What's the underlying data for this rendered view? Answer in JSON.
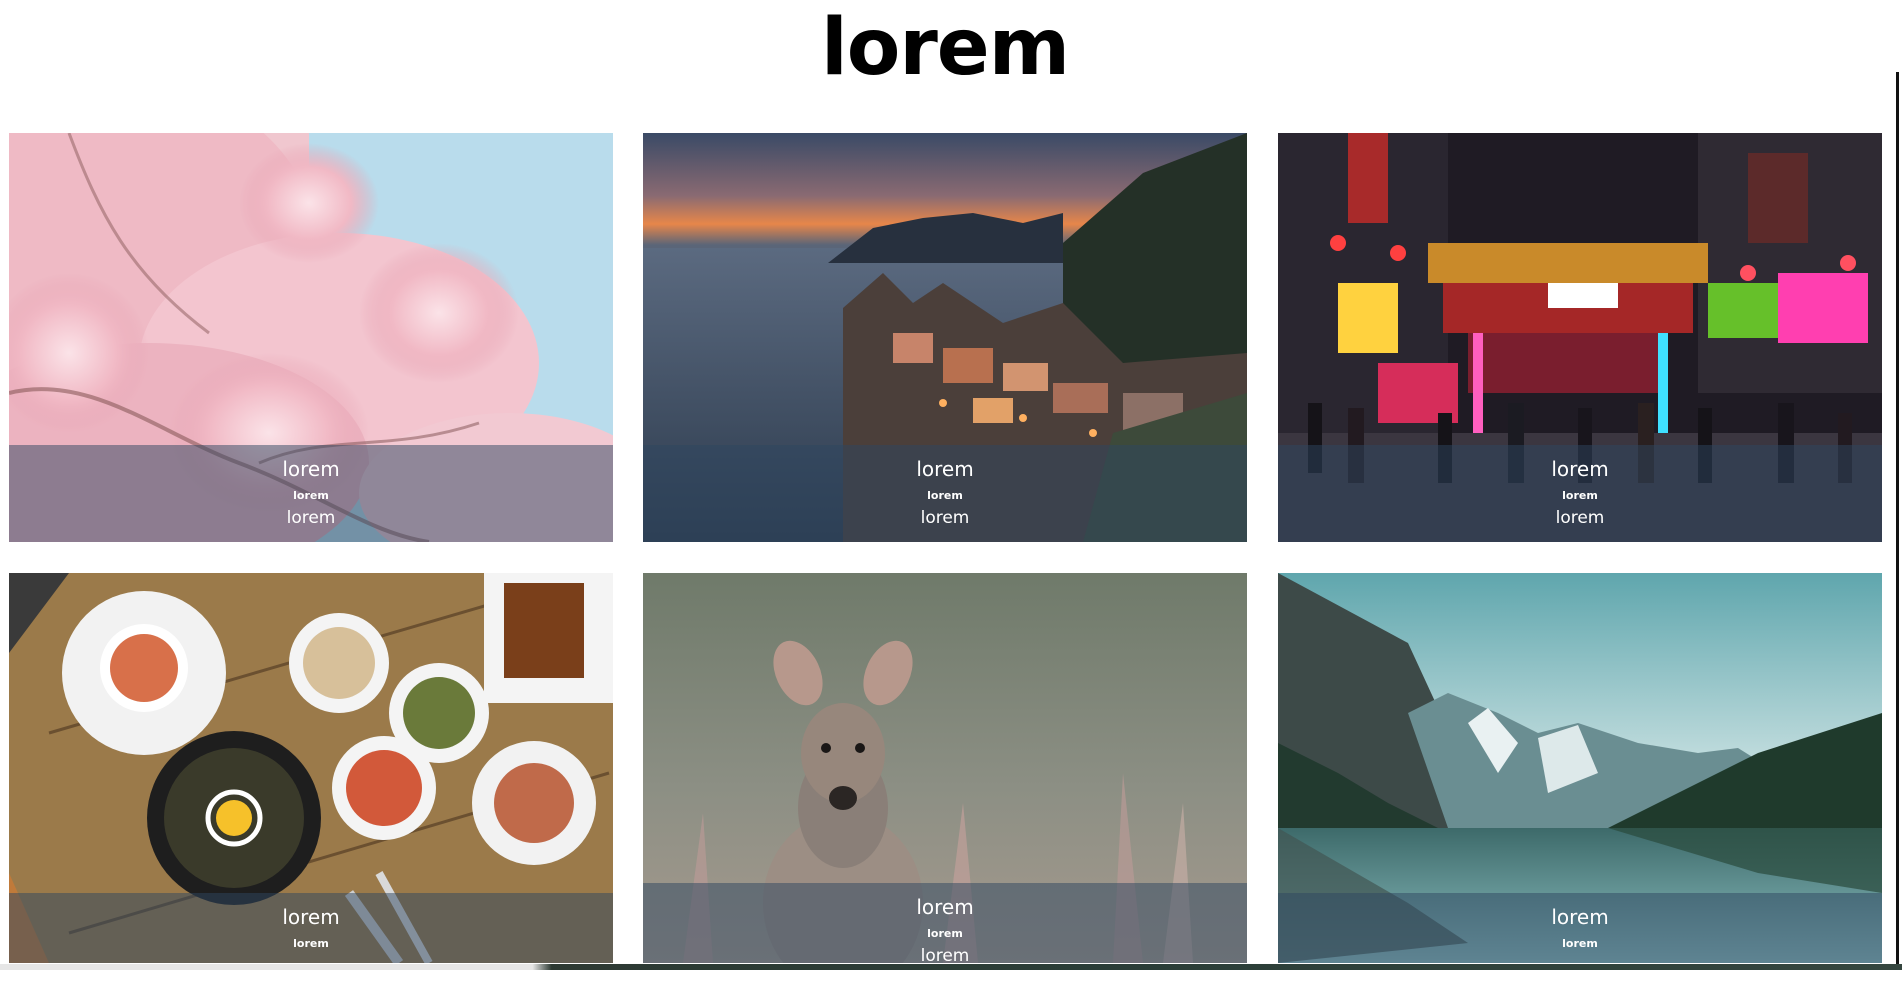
{
  "page": {
    "title": "lorem"
  },
  "cards": [
    {
      "image": "cherry-blossom-photo",
      "title": "lorem",
      "subtitle": "lorem",
      "text": "lorem"
    },
    {
      "image": "coastal-cliff-village-sunset-photo",
      "title": "lorem",
      "subtitle": "lorem",
      "text": "lorem"
    },
    {
      "image": "night-market-street-photo",
      "title": "lorem",
      "subtitle": "lorem",
      "text": "lorem"
    },
    {
      "image": "korean-food-table-photo",
      "title": "lorem",
      "subtitle": "lorem"
    },
    {
      "image": "wallaby-in-grass-photo",
      "title": "lorem",
      "subtitle": "lorem",
      "text": "lorem"
    },
    {
      "image": "mountain-lake-reflection-photo",
      "title": "lorem",
      "subtitle": "lorem"
    }
  ],
  "colors": {
    "caption_overlay": "#2d465f",
    "title_text": "#000000",
    "caption_text": "#ffffff"
  }
}
